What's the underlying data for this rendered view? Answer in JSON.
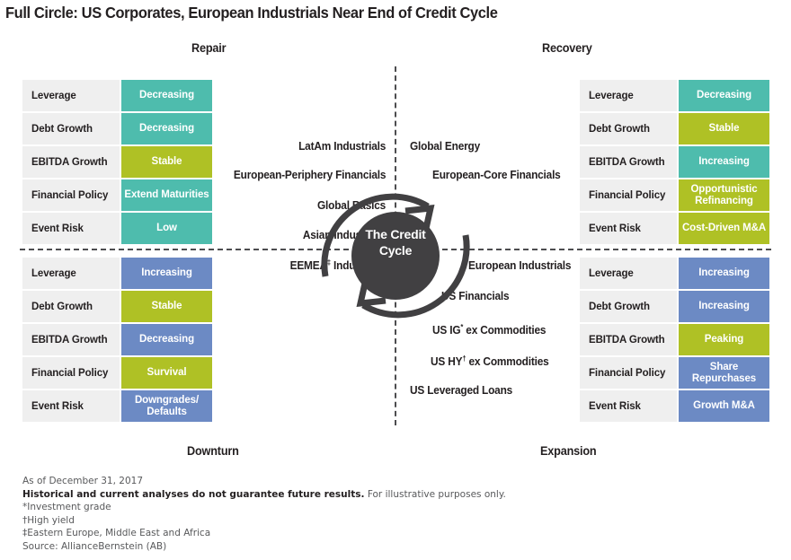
{
  "title": "Full Circle: US Corporates, European Industrials Near End of Credit Cycle",
  "quadrant_captions": {
    "top_left": "Repair",
    "top_right": "Recovery",
    "bottom_left": "Downturn",
    "bottom_right": "Expansion"
  },
  "center": {
    "line1": "The Credit",
    "line2": "Cycle"
  },
  "colors": {
    "teal": "#4ebcad",
    "olive": "#afc125",
    "blue": "#6c8ac4",
    "label_cell": "#efefef",
    "dark": "#414042",
    "text": "#231f20"
  },
  "attribute_names": [
    "Leverage",
    "Debt Growth",
    "EBITDA Growth",
    "Financial Policy",
    "Event Risk"
  ],
  "tables": {
    "repair": {
      "caption": "Repair",
      "rows": [
        {
          "label": "Leverage",
          "value": "Decreasing",
          "color": "teal"
        },
        {
          "label": "Debt Growth",
          "value": "Decreasing",
          "color": "teal"
        },
        {
          "label": "EBITDA Growth",
          "value": "Stable",
          "color": "olive"
        },
        {
          "label": "Financial Policy",
          "value": "Extend Maturities",
          "color": "teal"
        },
        {
          "label": "Event Risk",
          "value": "Low",
          "color": "teal"
        }
      ]
    },
    "recovery": {
      "caption": "Recovery",
      "rows": [
        {
          "label": "Leverage",
          "value": "Decreasing",
          "color": "teal"
        },
        {
          "label": "Debt Growth",
          "value": "Stable",
          "color": "olive"
        },
        {
          "label": "EBITDA Growth",
          "value": "Increasing",
          "color": "teal"
        },
        {
          "label": "Financial Policy",
          "value": "Opportunistic Refinancing",
          "color": "olive"
        },
        {
          "label": "Event Risk",
          "value": "Cost-Driven M&A",
          "color": "olive"
        }
      ]
    },
    "downturn": {
      "caption": "Downturn",
      "rows": [
        {
          "label": "Leverage",
          "value": "Increasing",
          "color": "blue"
        },
        {
          "label": "Debt Growth",
          "value": "Stable",
          "color": "olive"
        },
        {
          "label": "EBITDA Growth",
          "value": "Decreasing",
          "color": "blue"
        },
        {
          "label": "Financial Policy",
          "value": "Survival",
          "color": "olive"
        },
        {
          "label": "Event Risk",
          "value": "Downgrades/ Defaults",
          "color": "blue"
        }
      ]
    },
    "expansion": {
      "caption": "Expansion",
      "rows": [
        {
          "label": "Leverage",
          "value": "Increasing",
          "color": "blue"
        },
        {
          "label": "Debt Growth",
          "value": "Increasing",
          "color": "blue"
        },
        {
          "label": "EBITDA Growth",
          "value": "Peaking",
          "color": "olive"
        },
        {
          "label": "Financial Policy",
          "value": "Share Repurchases",
          "color": "blue"
        },
        {
          "label": "Event Risk",
          "value": "Growth M&A",
          "color": "blue"
        }
      ]
    }
  },
  "cycle_labels": {
    "latam_industrials": "LatAm Industrials",
    "european_periphery_financials": "European-Periphery Financials",
    "global_basics": "Global Basics",
    "asian_industrials": "Asian Industrials",
    "eemea_industrials": "EEMEA",
    "eemea_industrials_suffix": " Industrials",
    "eemea_marker": "‡",
    "global_energy": "Global Energy",
    "european_core_financials": "European-Core Financials",
    "european_industrials": "European Industrials",
    "us_financials": "US Financials",
    "us_ig_ex_commodities": "US IG",
    "us_ig_marker": "*",
    "us_ig_suffix": " ex Commodities",
    "us_hy_ex_commodities": "US HY",
    "us_hy_marker": "†",
    "us_hy_suffix": " ex Commodities",
    "us_leveraged_loans": "US Leveraged Loans"
  },
  "footnotes": {
    "as_of": "As of December 31, 2017",
    "disclaimer_bold": "Historical and current analyses do not guarantee future results.",
    "disclaimer_rest": " For illustrative purposes only.",
    "note_ig": "*Investment grade",
    "note_hy": "†High yield",
    "note_eemea": "‡Eastern Europe, Middle East and Africa",
    "source": "Source: AllianceBernstein (AB)"
  }
}
